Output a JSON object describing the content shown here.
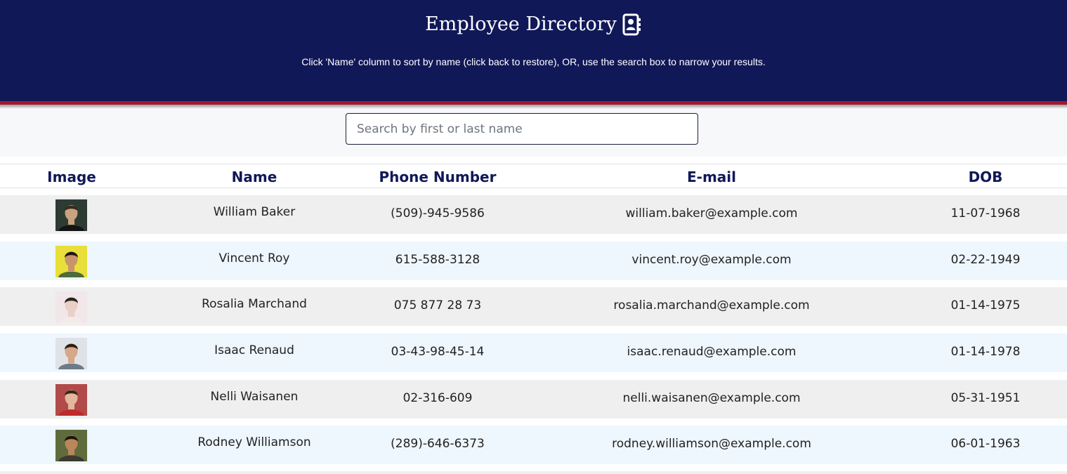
{
  "header": {
    "title": "Employee Directory",
    "subtitle": "Click 'Name' column to sort by name (click back to restore), OR, use the search box to narrow your results.",
    "icon": "address-book-icon",
    "colors": {
      "background": "#111858",
      "stripe": "#a3172f"
    }
  },
  "search": {
    "placeholder": "Search by first or last name",
    "value": ""
  },
  "table": {
    "columns": [
      "Image",
      "Name",
      "Phone Number",
      "E-mail",
      "DOB"
    ],
    "rows": [
      {
        "name": "William Baker",
        "phone": "(509)-945-9586",
        "email": "william.baker@example.com",
        "dob": "11-07-1968",
        "avatar": {
          "bg": "#2d3b33",
          "skin": "#c9a27e",
          "hair": "#3a2a1c",
          "shirt": "#141414"
        }
      },
      {
        "name": "Vincent Roy",
        "phone": "615-588-3128",
        "email": "vincent.roy@example.com",
        "dob": "02-22-1949",
        "avatar": {
          "bg": "#e8df3a",
          "skin": "#c7946b",
          "hair": "#1e1510",
          "shirt": "#4e6b3a"
        }
      },
      {
        "name": "Rosalia Marchand",
        "phone": "075 877 28 73",
        "email": "rosalia.marchand@example.com",
        "dob": "01-14-1975",
        "avatar": {
          "bg": "#f1e6e8",
          "skin": "#e9cfc6",
          "hair": "#2a211c",
          "shirt": "#f3eaea"
        }
      },
      {
        "name": "Isaac Renaud",
        "phone": "03-43-98-45-14",
        "email": "isaac.renaud@example.com",
        "dob": "01-14-1978",
        "avatar": {
          "bg": "#dfe3e8",
          "skin": "#d6a788",
          "hair": "#2b1d16",
          "shirt": "#6c7a8a"
        }
      },
      {
        "name": "Nelli Waisanen",
        "phone": "02-316-609",
        "email": "nelli.waisanen@example.com",
        "dob": "05-31-1951",
        "avatar": {
          "bg": "#b24a4a",
          "skin": "#e2b79b",
          "hair": "#3a251a",
          "shirt": "#c02a2a"
        }
      },
      {
        "name": "Rodney Williamson",
        "phone": "(289)-646-6373",
        "email": "rodney.williamson@example.com",
        "dob": "06-01-1963",
        "avatar": {
          "bg": "#5f6b3c",
          "skin": "#b9875a",
          "hair": "#1c130e",
          "shirt": "#3b3a2e"
        }
      }
    ]
  },
  "colors": {
    "header_text": "#111858",
    "row_odd": "#efefef",
    "row_even": "#eef6fe"
  }
}
